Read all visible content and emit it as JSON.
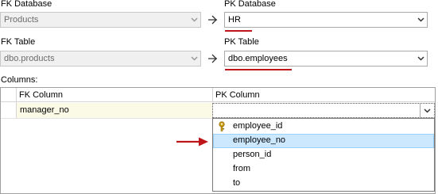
{
  "fk_database": {
    "label": "FK Database",
    "value": "Products"
  },
  "pk_database": {
    "label": "PK Database",
    "value": "HR"
  },
  "fk_table": {
    "label": "FK Table",
    "value": "dbo.products"
  },
  "pk_table": {
    "label": "PK Table",
    "value": "dbo.employees"
  },
  "columns": {
    "label": "Columns:",
    "headers": {
      "fk": "FK Column",
      "pk": "PK Column"
    },
    "rows": [
      {
        "fk": "manager_no",
        "pk": ""
      }
    ]
  },
  "pk_column_options": [
    {
      "label": "employee_id",
      "icon": "key-icon",
      "selected": false
    },
    {
      "label": "employee_no",
      "icon": "",
      "selected": true
    },
    {
      "label": "person_id",
      "icon": "",
      "selected": false
    },
    {
      "label": "from",
      "icon": "",
      "selected": false
    },
    {
      "label": "to",
      "icon": "",
      "selected": false
    }
  ],
  "colors": {
    "annotation_red": "#c0141b",
    "selection": "#cce8ff",
    "key_gold": "#d4a017"
  }
}
